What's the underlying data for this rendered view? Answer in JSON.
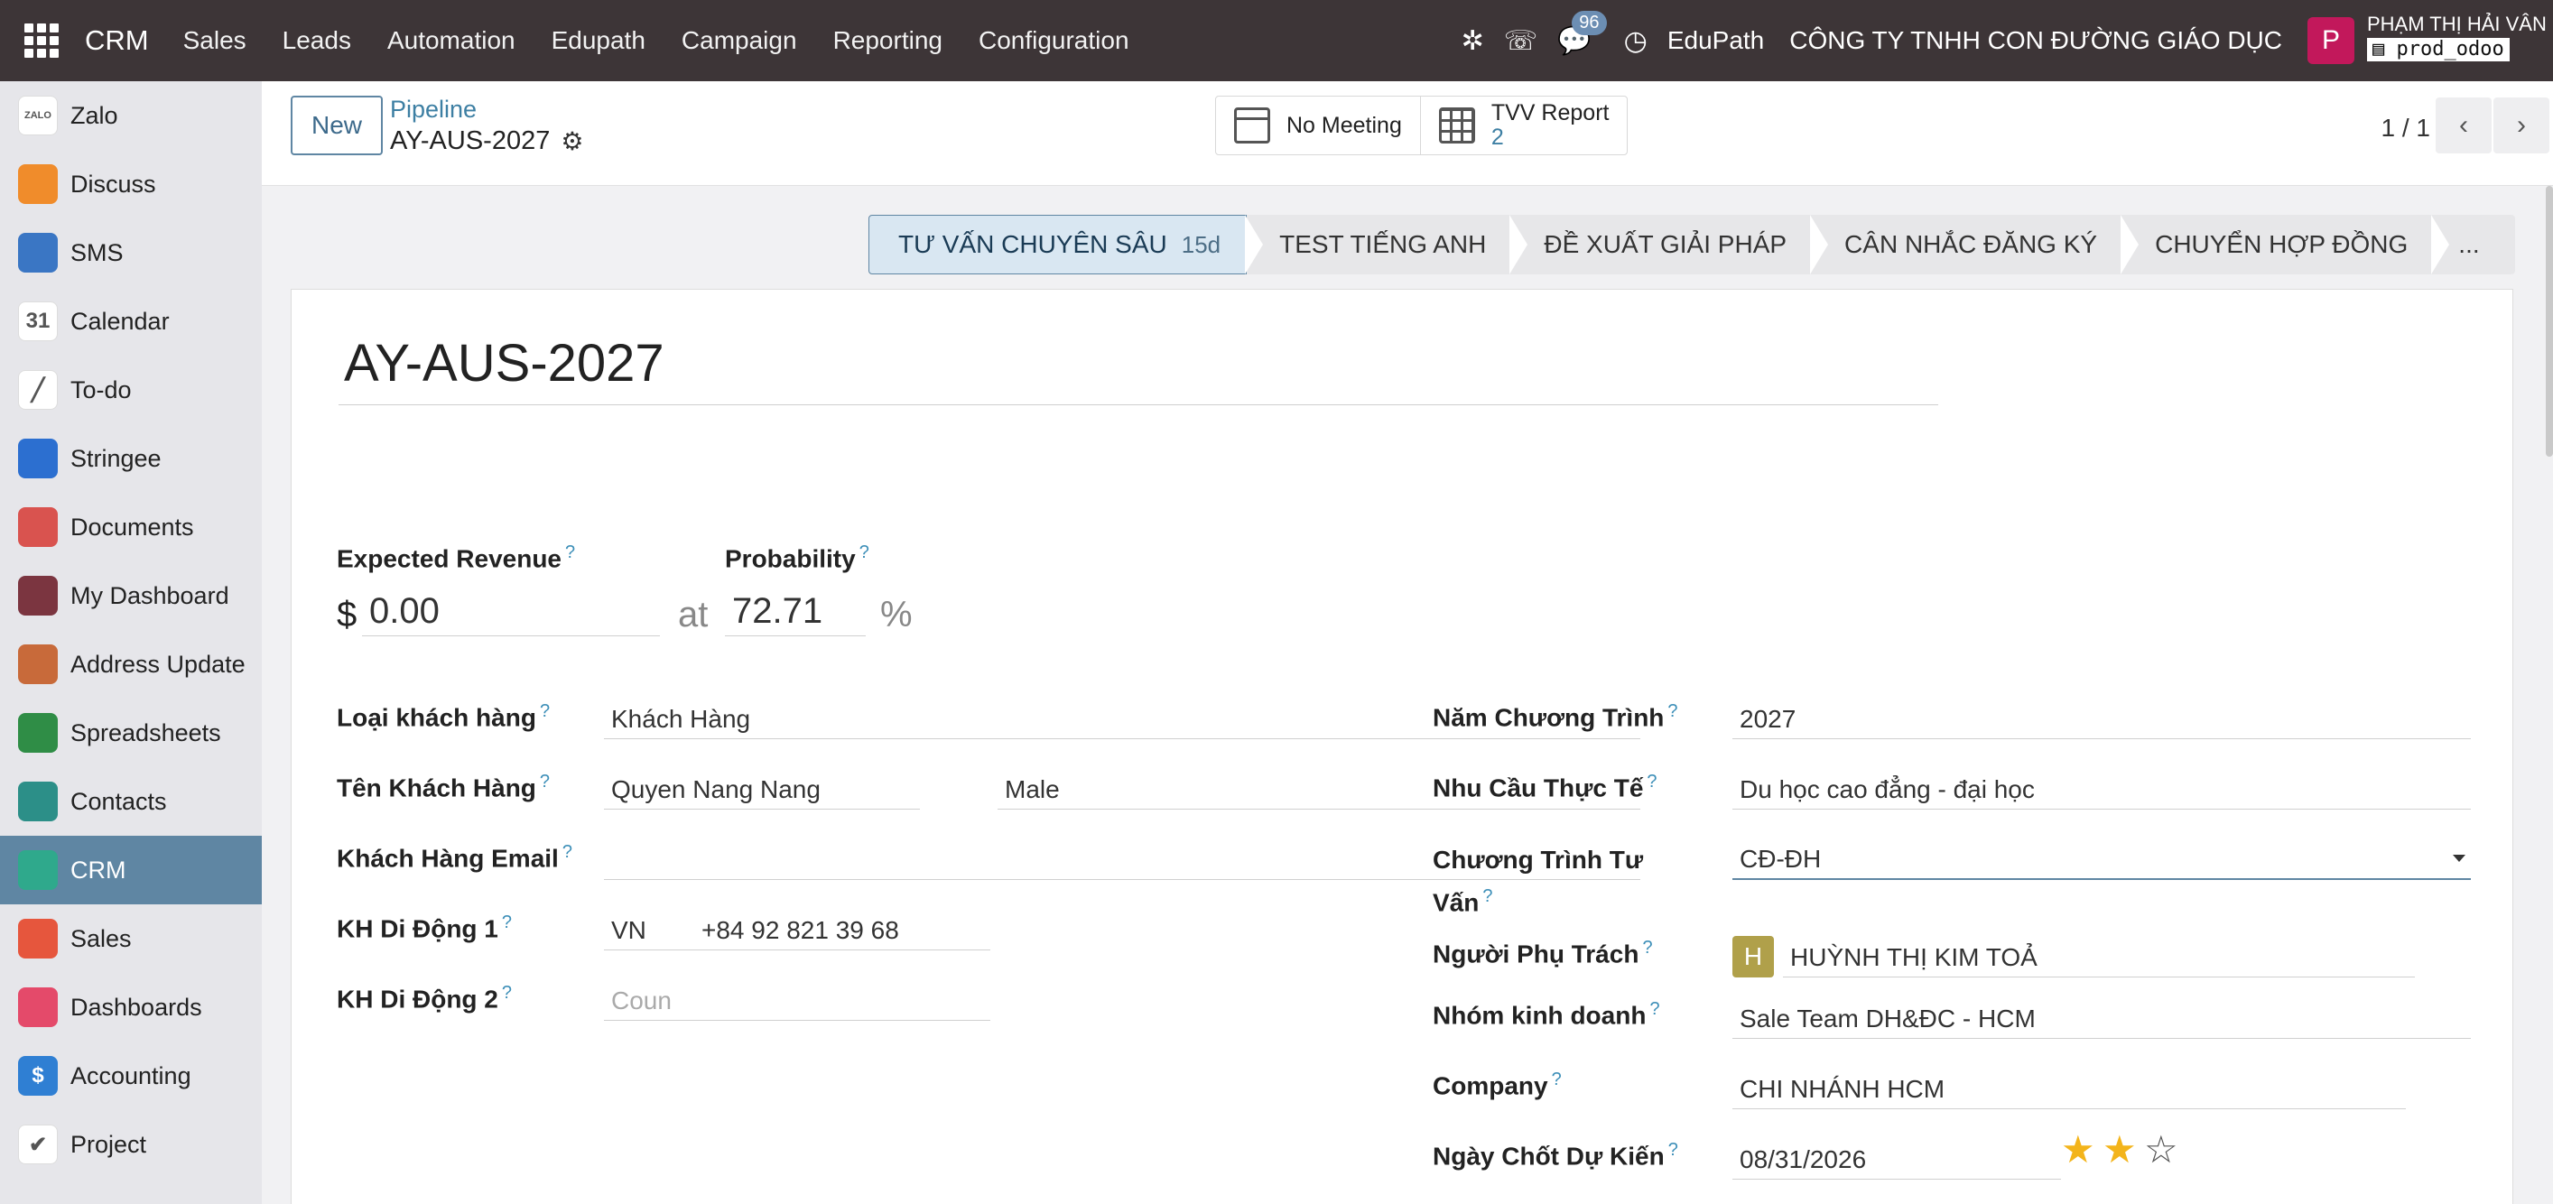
{
  "navbar": {
    "brand": "CRM",
    "menu": [
      "Sales",
      "Leads",
      "Automation",
      "Edupath",
      "Campaign",
      "Reporting",
      "Configuration"
    ],
    "message_count": "96",
    "company_short": "EduPath",
    "company_full": "CÔNG TY TNHH CON ĐƯỜNG GIÁO DỤC",
    "avatar_letter": "P",
    "user_name": "PHẠM THỊ HẢI VÂN",
    "database": "prod_odoo"
  },
  "sidebar": [
    {
      "label": "Zalo",
      "icon": "zalo-icon",
      "color": "#ffffff",
      "glyph": "ZALO"
    },
    {
      "label": "Discuss",
      "icon": "discuss-icon",
      "color": "#f08c2b",
      "glyph": ""
    },
    {
      "label": "SMS",
      "icon": "sms-icon",
      "color": "#3a76c4",
      "glyph": ""
    },
    {
      "label": "Calendar",
      "icon": "calendar-icon",
      "color": "#ffffff",
      "glyph": "31"
    },
    {
      "label": "To-do",
      "icon": "todo-icon",
      "color": "#ffffff",
      "glyph": "╱"
    },
    {
      "label": "Stringee",
      "icon": "stringee-icon",
      "color": "#2c6fd0",
      "glyph": ""
    },
    {
      "label": "Documents",
      "icon": "documents-icon",
      "color": "#d9534f",
      "glyph": ""
    },
    {
      "label": "My Dashboard",
      "icon": "my-dashboard-icon",
      "color": "#7b3540",
      "glyph": ""
    },
    {
      "label": "Address Update",
      "icon": "address-update-icon",
      "color": "#c86a3a",
      "glyph": ""
    },
    {
      "label": "Spreadsheets",
      "icon": "spreadsheets-icon",
      "color": "#2f8d46",
      "glyph": ""
    },
    {
      "label": "Contacts",
      "icon": "contacts-icon",
      "color": "#2c8f88",
      "glyph": ""
    },
    {
      "label": "CRM",
      "icon": "crm-icon",
      "color": "#2fa98c",
      "glyph": ""
    },
    {
      "label": "Sales",
      "icon": "sales-icon",
      "color": "#e6563d",
      "glyph": ""
    },
    {
      "label": "Dashboards",
      "icon": "dashboards-icon",
      "color": "#e44a6a",
      "glyph": ""
    },
    {
      "label": "Accounting",
      "icon": "accounting-icon",
      "color": "#2f7fd3",
      "glyph": "$"
    },
    {
      "label": "Project",
      "icon": "project-icon",
      "color": "#ffffff",
      "glyph": "✔"
    }
  ],
  "control": {
    "new_label": "New",
    "breadcrumb_parent": "Pipeline",
    "breadcrumb_current": "AY-AUS-2027",
    "meeting_label": "No Meeting",
    "report_label": "TVV Report",
    "report_count": "2",
    "pager": "1 / 1"
  },
  "stages": {
    "active_label": "TƯ VẤN CHUYÊN SÂU",
    "active_days": "15d",
    "others": [
      "TEST TIẾNG ANH",
      "ĐỀ XUẤT GIẢI PHÁP",
      "CÂN NHẮC ĐĂNG KÝ",
      "CHUYỂN HỢP ĐỒNG"
    ],
    "more": "..."
  },
  "form": {
    "title": "AY-AUS-2027",
    "expected_revenue_label": "Expected Revenue",
    "currency": "$",
    "expected_revenue": "0.00",
    "at": "at",
    "probability_label": "Probability",
    "probability": "72.71",
    "percent": "%",
    "help": "?",
    "left": {
      "customer_type_label": "Loại khách hàng",
      "customer_type": "Khách Hàng",
      "customer_name_label": "Tên Khách Hàng",
      "customer_name": "Quyen Nang Nang",
      "gender": "Male",
      "email_label": "Khách Hàng Email",
      "email": "",
      "mobile1_label": "KH Di Động 1",
      "mobile1_country": "VN",
      "mobile1": "+84 92 821 39 68",
      "mobile2_label": "KH Di Động 2",
      "mobile2_placeholder": "Coun"
    },
    "right": {
      "program_year_label": "Năm Chương Trình",
      "program_year": "2027",
      "real_need_label": "Nhu Cầu Thực Tế",
      "real_need": "Du học cao đẳng - đại học",
      "program_label_1": "Chương Trình Tư",
      "program_label_2": "Vấn",
      "program": "CĐ-ĐH",
      "owner_label": "Người Phụ Trách",
      "owner_avatar": "H",
      "owner": "HUỲNH THỊ KIM TOẢ",
      "team_label": "Nhóm kinh doanh",
      "team": "Sale Team DH&ĐC - HCM",
      "company_label": "Company",
      "company": "CHI NHÁNH HCM",
      "deadline_label": "Ngày Chốt Dự Kiến",
      "deadline": "08/31/2026",
      "priority": 2,
      "priority_max": 3
    }
  }
}
